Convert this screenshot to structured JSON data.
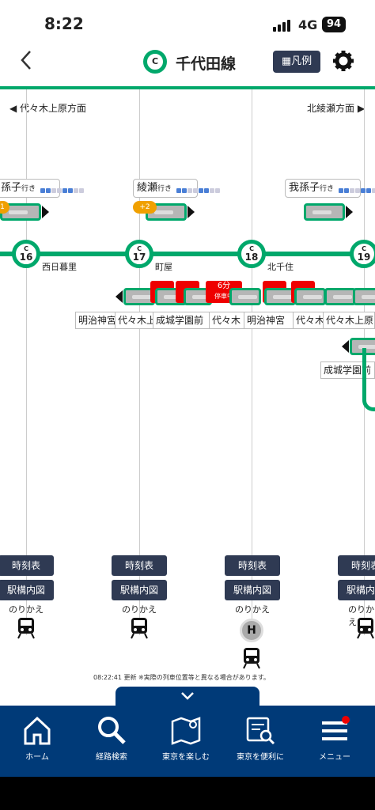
{
  "status": {
    "time": "8:22",
    "network": "4G",
    "battery": "94"
  },
  "header": {
    "title": "千代田線",
    "line_code": "C",
    "legend": "凡例"
  },
  "directions": {
    "left": "◀ 代々木上原方面",
    "right": "北綾瀬方面 ▶"
  },
  "stations": [
    {
      "code": "C",
      "number": "16",
      "name": "西日暮里"
    },
    {
      "code": "C",
      "number": "17",
      "name": "町屋"
    },
    {
      "code": "C",
      "number": "18",
      "name": "北千住"
    },
    {
      "code": "C",
      "number": "19",
      "name": ""
    }
  ],
  "upper_trains": [
    {
      "dest": "孫子",
      "suffix": "行き",
      "badge": "1"
    },
    {
      "dest": "綾瀬",
      "suffix": "行き",
      "badge": "+2"
    },
    {
      "dest": "我孫子",
      "suffix": "行き",
      "badge": ""
    }
  ],
  "red_tags": [
    {
      "line1": "6分",
      "line2": "停車中"
    }
  ],
  "lower_destinations": [
    "明治神宮",
    "代々木上",
    "成城学園前",
    "代々木",
    "明治神宮",
    "代々木",
    "代々木上原",
    "成城学園前"
  ],
  "station_buttons": {
    "timetable": "時刻表",
    "map": "駅構内図",
    "transfer": "のりかえ",
    "h": "H"
  },
  "update_text": "08:22:41 更新 ※実際の列車位置等と異なる場合があります。",
  "nav": [
    {
      "label": "ホーム",
      "icon": "home-icon"
    },
    {
      "label": "経路検索",
      "icon": "search-icon"
    },
    {
      "label": "東京を楽しむ",
      "icon": "map-icon"
    },
    {
      "label": "東京を便利に",
      "icon": "doc-search-icon"
    },
    {
      "label": "メニュー",
      "icon": "menu-icon"
    }
  ],
  "colors": {
    "line": "#00a86b",
    "nav": "#003a78",
    "button": "#2f3a53",
    "alert": "#e00000",
    "delay": "#f0a000"
  }
}
